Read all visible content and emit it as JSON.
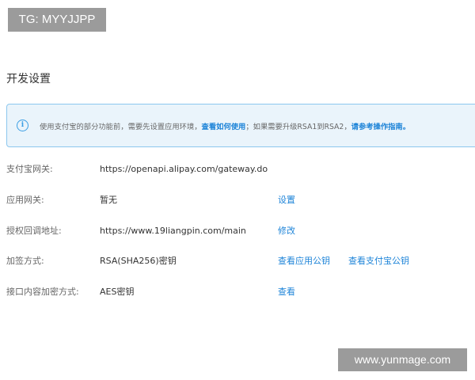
{
  "watermarks": {
    "top_left": "TG: MYYJJPP",
    "bottom_right": "www.yunmage.com"
  },
  "page": {
    "title": "开发设置"
  },
  "notice": {
    "icon": "info-icon",
    "text_part1": "使用支付宝的部分功能前，需要先设置应用环境，",
    "link1": "查看如何使用",
    "text_part2": "；如果需要升级RSA1到RSA2，",
    "link2": "请参考操作指南。"
  },
  "settings": {
    "gateway": {
      "label": "支付宝网关:",
      "value": "https://openapi.alipay.com/gateway.do"
    },
    "app_gateway": {
      "label": "应用网关:",
      "value": "暂无",
      "action": "设置"
    },
    "callback_url": {
      "label": "授权回调地址:",
      "value": "https://www.19liangpin.com/main",
      "action": "修改"
    },
    "sign_method": {
      "label": "加签方式:",
      "value": "RSA(SHA256)密钥",
      "action1": "查看应用公钥",
      "action2": "查看支付宝公钥"
    },
    "encryption": {
      "label": "接口内容加密方式:",
      "value": "AES密钥",
      "action": "查看"
    }
  }
}
